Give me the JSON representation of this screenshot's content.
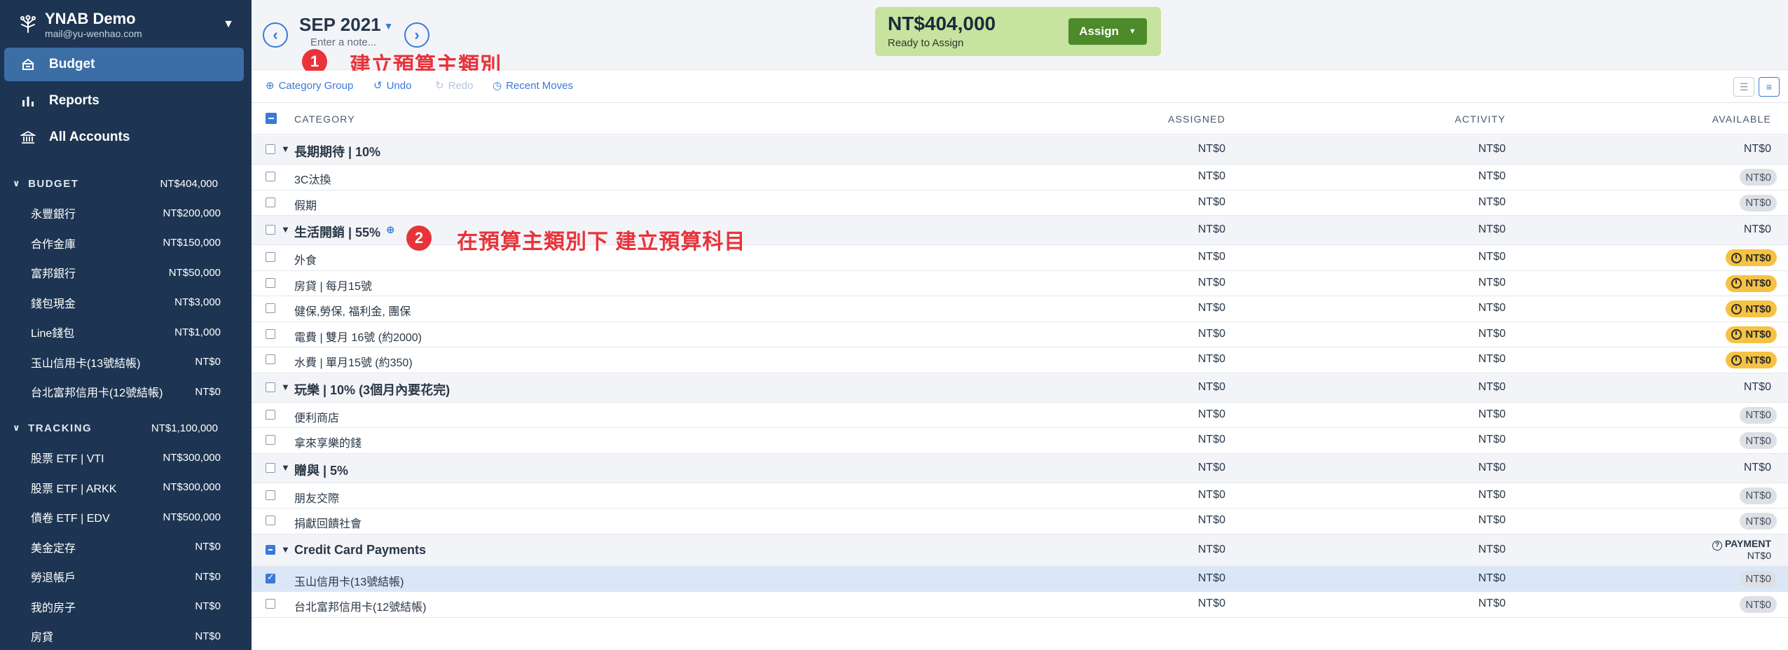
{
  "sidebar": {
    "app_name": "YNAB Demo",
    "email": "mail@yu-wenhao.com",
    "nav": [
      {
        "label": "Budget",
        "icon": "budget-icon"
      },
      {
        "label": "Reports",
        "icon": "reports-icon"
      },
      {
        "label": "All Accounts",
        "icon": "bank-icon"
      }
    ],
    "budget_group": {
      "label": "BUDGET",
      "amount": "NT$404,000"
    },
    "budget_accounts": [
      {
        "name": "永豐銀行",
        "amount": "NT$200,000"
      },
      {
        "name": "合作金庫",
        "amount": "NT$150,000"
      },
      {
        "name": "富邦銀行",
        "amount": "NT$50,000"
      },
      {
        "name": "錢包現金",
        "amount": "NT$3,000"
      },
      {
        "name": "Line錢包",
        "amount": "NT$1,000"
      },
      {
        "name": "玉山信用卡(13號結帳)",
        "amount": "NT$0"
      },
      {
        "name": "台北富邦信用卡(12號結帳)",
        "amount": "NT$0"
      }
    ],
    "tracking_group": {
      "label": "TRACKING",
      "amount": "NT$1,100,000"
    },
    "tracking_accounts": [
      {
        "name": "股票 ETF | VTI",
        "amount": "NT$300,000"
      },
      {
        "name": "股票 ETF | ARKK",
        "amount": "NT$300,000"
      },
      {
        "name": "債卷 ETF | EDV",
        "amount": "NT$500,000"
      },
      {
        "name": "美金定存",
        "amount": "NT$0"
      },
      {
        "name": "勞退帳戶",
        "amount": "NT$0"
      },
      {
        "name": "我的房子",
        "amount": "NT$0"
      },
      {
        "name": "房貸",
        "amount": "NT$0"
      }
    ]
  },
  "header": {
    "month": "SEP 2021",
    "note_placeholder": "Enter a note...",
    "ready_amount": "NT$404,000",
    "ready_label": "Ready to Assign",
    "assign_label": "Assign"
  },
  "annotations": {
    "one_num": "1",
    "one_text": "建立預算主類別",
    "two_num": "2",
    "two_text": "在預算主類別下 建立預算科目",
    "color": "#e8333a"
  },
  "toolbar": {
    "category_group": "Category Group",
    "undo": "Undo",
    "redo": "Redo",
    "recent_moves": "Recent Moves"
  },
  "table": {
    "headers": {
      "category": "CATEGORY",
      "assigned": "ASSIGNED",
      "activity": "ACTIVITY",
      "available": "AVAILABLE"
    },
    "rows": [
      {
        "type": "group",
        "name": "長期期待 | 10%",
        "assigned": "NT$0",
        "activity": "NT$0",
        "available": "NT$0"
      },
      {
        "type": "item",
        "name": "3C汰換",
        "assigned": "NT$0",
        "activity": "NT$0",
        "available": "NT$0",
        "status": "neutral"
      },
      {
        "type": "item",
        "name": "假期",
        "assigned": "NT$0",
        "activity": "NT$0",
        "available": "NT$0",
        "status": "neutral"
      },
      {
        "type": "group",
        "name": "生活開銷 | 55%",
        "assigned": "NT$0",
        "activity": "NT$0",
        "available": "NT$0",
        "has_add": true
      },
      {
        "type": "item",
        "name": "外食",
        "assigned": "NT$0",
        "activity": "NT$0",
        "available": "NT$0",
        "status": "warn"
      },
      {
        "type": "item",
        "name": "房貸 | 每月15號",
        "assigned": "NT$0",
        "activity": "NT$0",
        "available": "NT$0",
        "status": "warn"
      },
      {
        "type": "item",
        "name": "健保,勞保, 福利金, 團保",
        "assigned": "NT$0",
        "activity": "NT$0",
        "available": "NT$0",
        "status": "warn"
      },
      {
        "type": "item",
        "name": "電費 | 雙月 16號 (約2000)",
        "assigned": "NT$0",
        "activity": "NT$0",
        "available": "NT$0",
        "status": "warn"
      },
      {
        "type": "item",
        "name": "水費 | 單月15號 (約350)",
        "assigned": "NT$0",
        "activity": "NT$0",
        "available": "NT$0",
        "status": "warn"
      },
      {
        "type": "group",
        "name": "玩樂 | 10% (3個月內要花完)",
        "assigned": "NT$0",
        "activity": "NT$0",
        "available": "NT$0"
      },
      {
        "type": "item",
        "name": "便利商店",
        "assigned": "NT$0",
        "activity": "NT$0",
        "available": "NT$0",
        "status": "neutral"
      },
      {
        "type": "item",
        "name": "拿來享樂的錢",
        "assigned": "NT$0",
        "activity": "NT$0",
        "available": "NT$0",
        "status": "neutral"
      },
      {
        "type": "group",
        "name": "贈與 | 5%",
        "assigned": "NT$0",
        "activity": "NT$0",
        "available": "NT$0"
      },
      {
        "type": "item",
        "name": "朋友交際",
        "assigned": "NT$0",
        "activity": "NT$0",
        "available": "NT$0",
        "status": "neutral"
      },
      {
        "type": "item",
        "name": "捐獻回饋社會",
        "assigned": "NT$0",
        "activity": "NT$0",
        "available": "NT$0",
        "status": "neutral"
      },
      {
        "type": "group",
        "name": "Credit Card Payments",
        "assigned": "NT$0",
        "activity": "NT$0",
        "available": "NT$0",
        "payment_label": "PAYMENT",
        "checkbox": "partial"
      },
      {
        "type": "item",
        "name": "玉山信用卡(13號結帳)",
        "assigned": "NT$0",
        "activity": "NT$0",
        "available": "NT$0",
        "status": "neutral",
        "selected": true
      },
      {
        "type": "item",
        "name": "台北富邦信用卡(12號結帳)",
        "assigned": "NT$0",
        "activity": "NT$0",
        "available": "NT$0",
        "status": "neutral"
      }
    ]
  }
}
